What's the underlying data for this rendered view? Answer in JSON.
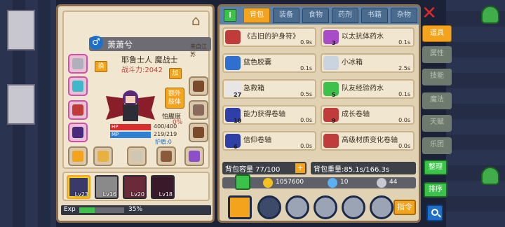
{
  "character": {
    "name": "萧萧兮",
    "origin": "来自江苏",
    "title": "耶鲁士人 魔战士",
    "power": "战斗力:2042",
    "swap_label": "换",
    "add_label": "加",
    "extra_body_label": "额外肢体",
    "fear_label": "怕腥度",
    "fear_value": "0%",
    "hp_label": "HP",
    "hp_value": "400/400",
    "hp_fraction": 1.0,
    "mp_label": "MP",
    "mp_value": "219/219",
    "mp_fraction": 1.0,
    "shield_label": "护盾:0",
    "exp_label": "Exp",
    "exp_value": "35%",
    "exp_fraction": 0.35
  },
  "team": [
    {
      "level": "Lv23",
      "selected": true
    },
    {
      "level": "Lv16",
      "selected": false
    },
    {
      "level": "Lv20",
      "selected": false
    },
    {
      "level": "Lv18",
      "selected": false
    }
  ],
  "inventory": {
    "tabs": [
      "背包",
      "装备",
      "食物",
      "药剂",
      "书籍",
      "杂物"
    ],
    "active_tab": "背包",
    "items": [
      {
        "name": "《古旧的护身符》",
        "time": "0.9s",
        "count": "",
        "color": "#c23b3b"
      },
      {
        "name": "以太抗体药水",
        "time": "0.1s",
        "count": "3",
        "color": "#a84cc9"
      },
      {
        "name": "蓝色胶囊",
        "time": "0.1s",
        "count": "",
        "color": "#2f6fd0"
      },
      {
        "name": "小冰箱",
        "time": "2.5s",
        "count": "",
        "color": "#c9d4e0"
      },
      {
        "name": "急救箱",
        "time": "0.5s",
        "count": "27",
        "color": "#e6e6e6"
      },
      {
        "name": "队友经验药水",
        "time": "0.1s",
        "count": "5",
        "color": "#3cc14a"
      },
      {
        "name": "能力获得卷轴",
        "time": "0.0s",
        "count": "10",
        "color": "#2f3fa8"
      },
      {
        "name": "成长卷轴",
        "time": "0.0s",
        "count": "9",
        "color": "#c23b3b"
      },
      {
        "name": "信仰卷轴",
        "time": "0.0s",
        "count": "6",
        "color": "#2f3fa8"
      },
      {
        "name": "高级材质变化卷轴",
        "time": "0.0s",
        "count": "",
        "color": "#c23b3b"
      }
    ],
    "capacity": "背包容量 77/100",
    "weight": "背包重量:85.1s/166.3s",
    "gold": "1057600",
    "gems": "10",
    "coins": "44",
    "command_label": "指令"
  },
  "side": {
    "tabs": [
      "道具",
      "属性",
      "技能",
      "魔法",
      "天赋",
      "乐团"
    ],
    "active": "道具",
    "organize_label": "整理",
    "sort_label": "排序"
  }
}
